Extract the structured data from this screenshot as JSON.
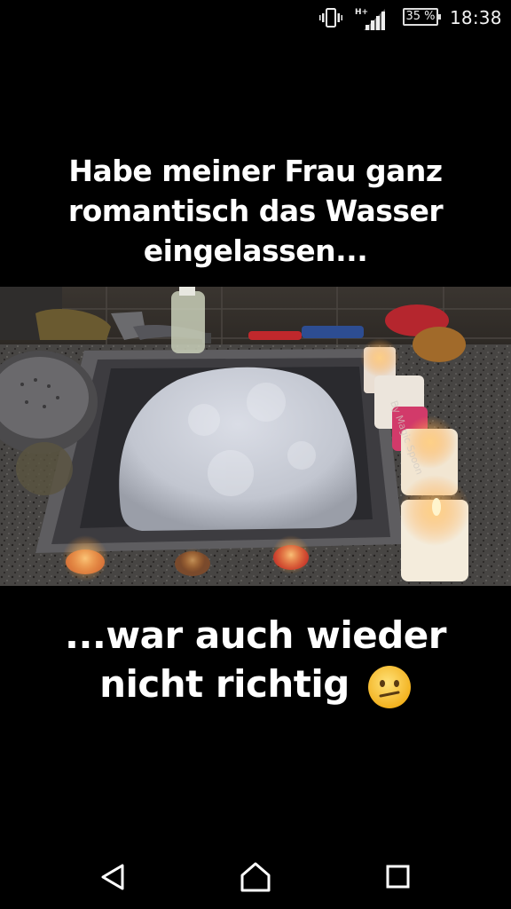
{
  "status_bar": {
    "network": "H+",
    "battery": "35 %",
    "time": "18:38"
  },
  "caption_top": {
    "line1": "Habe meiner Frau ganz",
    "line2": "romantisch das Wasser",
    "line3": "eingelassen..."
  },
  "caption_bottom": {
    "line1": "...war auch wieder",
    "line2": "nicht richtig"
  },
  "photo": {
    "watermark": "By Magic Spoon"
  },
  "icons": {
    "vibrate": "vibrate-icon",
    "signal": "signal-icon",
    "battery": "battery-icon",
    "emoji": "confused-face-emoji",
    "back": "back-triangle-icon",
    "home": "home-icon",
    "recents": "recents-square-icon"
  }
}
